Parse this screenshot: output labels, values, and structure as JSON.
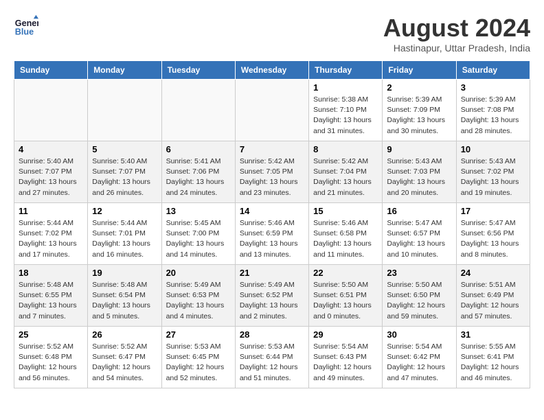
{
  "header": {
    "logo_general": "General",
    "logo_blue": "Blue",
    "month_year": "August 2024",
    "location": "Hastinapur, Uttar Pradesh, India"
  },
  "days_of_week": [
    "Sunday",
    "Monday",
    "Tuesday",
    "Wednesday",
    "Thursday",
    "Friday",
    "Saturday"
  ],
  "weeks": [
    [
      {
        "day": "",
        "info": ""
      },
      {
        "day": "",
        "info": ""
      },
      {
        "day": "",
        "info": ""
      },
      {
        "day": "",
        "info": ""
      },
      {
        "day": "1",
        "info": "Sunrise: 5:38 AM\nSunset: 7:10 PM\nDaylight: 13 hours\nand 31 minutes."
      },
      {
        "day": "2",
        "info": "Sunrise: 5:39 AM\nSunset: 7:09 PM\nDaylight: 13 hours\nand 30 minutes."
      },
      {
        "day": "3",
        "info": "Sunrise: 5:39 AM\nSunset: 7:08 PM\nDaylight: 13 hours\nand 28 minutes."
      }
    ],
    [
      {
        "day": "4",
        "info": "Sunrise: 5:40 AM\nSunset: 7:07 PM\nDaylight: 13 hours\nand 27 minutes."
      },
      {
        "day": "5",
        "info": "Sunrise: 5:40 AM\nSunset: 7:07 PM\nDaylight: 13 hours\nand 26 minutes."
      },
      {
        "day": "6",
        "info": "Sunrise: 5:41 AM\nSunset: 7:06 PM\nDaylight: 13 hours\nand 24 minutes."
      },
      {
        "day": "7",
        "info": "Sunrise: 5:42 AM\nSunset: 7:05 PM\nDaylight: 13 hours\nand 23 minutes."
      },
      {
        "day": "8",
        "info": "Sunrise: 5:42 AM\nSunset: 7:04 PM\nDaylight: 13 hours\nand 21 minutes."
      },
      {
        "day": "9",
        "info": "Sunrise: 5:43 AM\nSunset: 7:03 PM\nDaylight: 13 hours\nand 20 minutes."
      },
      {
        "day": "10",
        "info": "Sunrise: 5:43 AM\nSunset: 7:02 PM\nDaylight: 13 hours\nand 19 minutes."
      }
    ],
    [
      {
        "day": "11",
        "info": "Sunrise: 5:44 AM\nSunset: 7:02 PM\nDaylight: 13 hours\nand 17 minutes."
      },
      {
        "day": "12",
        "info": "Sunrise: 5:44 AM\nSunset: 7:01 PM\nDaylight: 13 hours\nand 16 minutes."
      },
      {
        "day": "13",
        "info": "Sunrise: 5:45 AM\nSunset: 7:00 PM\nDaylight: 13 hours\nand 14 minutes."
      },
      {
        "day": "14",
        "info": "Sunrise: 5:46 AM\nSunset: 6:59 PM\nDaylight: 13 hours\nand 13 minutes."
      },
      {
        "day": "15",
        "info": "Sunrise: 5:46 AM\nSunset: 6:58 PM\nDaylight: 13 hours\nand 11 minutes."
      },
      {
        "day": "16",
        "info": "Sunrise: 5:47 AM\nSunset: 6:57 PM\nDaylight: 13 hours\nand 10 minutes."
      },
      {
        "day": "17",
        "info": "Sunrise: 5:47 AM\nSunset: 6:56 PM\nDaylight: 13 hours\nand 8 minutes."
      }
    ],
    [
      {
        "day": "18",
        "info": "Sunrise: 5:48 AM\nSunset: 6:55 PM\nDaylight: 13 hours\nand 7 minutes."
      },
      {
        "day": "19",
        "info": "Sunrise: 5:48 AM\nSunset: 6:54 PM\nDaylight: 13 hours\nand 5 minutes."
      },
      {
        "day": "20",
        "info": "Sunrise: 5:49 AM\nSunset: 6:53 PM\nDaylight: 13 hours\nand 4 minutes."
      },
      {
        "day": "21",
        "info": "Sunrise: 5:49 AM\nSunset: 6:52 PM\nDaylight: 13 hours\nand 2 minutes."
      },
      {
        "day": "22",
        "info": "Sunrise: 5:50 AM\nSunset: 6:51 PM\nDaylight: 13 hours\nand 0 minutes."
      },
      {
        "day": "23",
        "info": "Sunrise: 5:50 AM\nSunset: 6:50 PM\nDaylight: 12 hours\nand 59 minutes."
      },
      {
        "day": "24",
        "info": "Sunrise: 5:51 AM\nSunset: 6:49 PM\nDaylight: 12 hours\nand 57 minutes."
      }
    ],
    [
      {
        "day": "25",
        "info": "Sunrise: 5:52 AM\nSunset: 6:48 PM\nDaylight: 12 hours\nand 56 minutes."
      },
      {
        "day": "26",
        "info": "Sunrise: 5:52 AM\nSunset: 6:47 PM\nDaylight: 12 hours\nand 54 minutes."
      },
      {
        "day": "27",
        "info": "Sunrise: 5:53 AM\nSunset: 6:45 PM\nDaylight: 12 hours\nand 52 minutes."
      },
      {
        "day": "28",
        "info": "Sunrise: 5:53 AM\nSunset: 6:44 PM\nDaylight: 12 hours\nand 51 minutes."
      },
      {
        "day": "29",
        "info": "Sunrise: 5:54 AM\nSunset: 6:43 PM\nDaylight: 12 hours\nand 49 minutes."
      },
      {
        "day": "30",
        "info": "Sunrise: 5:54 AM\nSunset: 6:42 PM\nDaylight: 12 hours\nand 47 minutes."
      },
      {
        "day": "31",
        "info": "Sunrise: 5:55 AM\nSunset: 6:41 PM\nDaylight: 12 hours\nand 46 minutes."
      }
    ]
  ]
}
